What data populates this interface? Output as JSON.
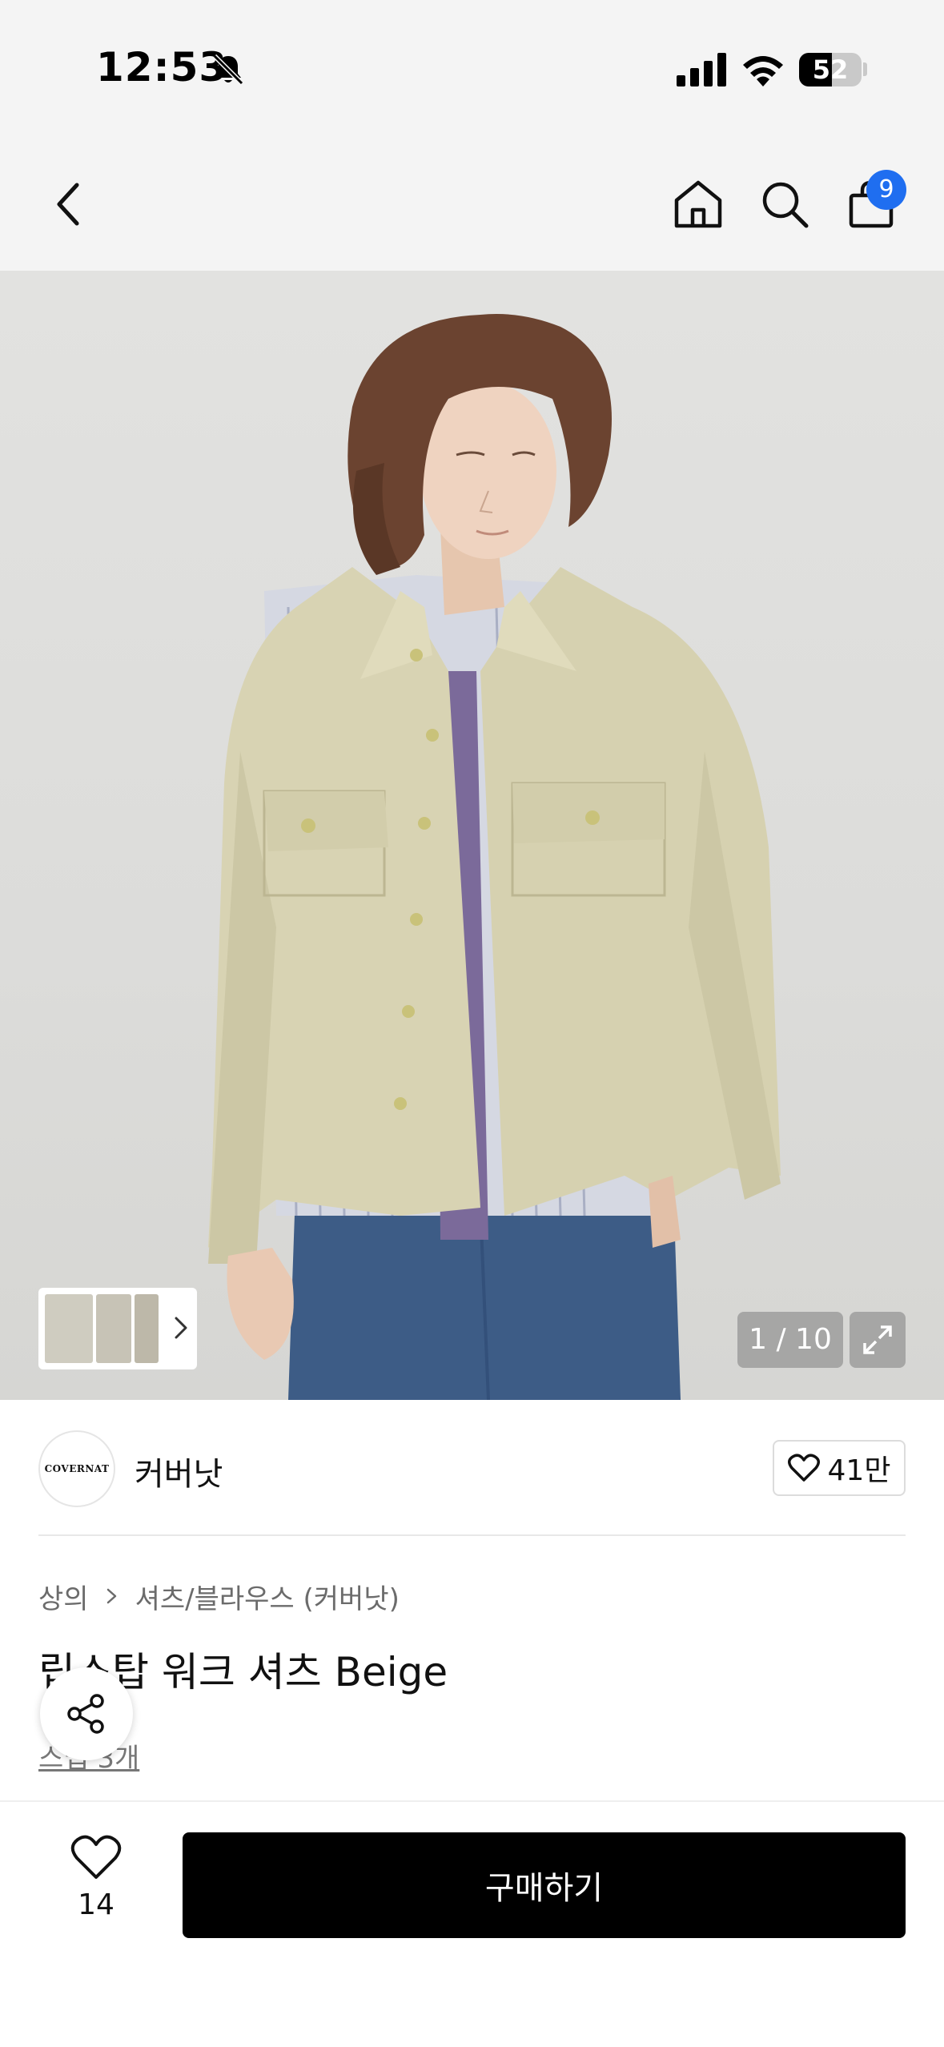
{
  "status_bar": {
    "time": "12:53",
    "battery": "52",
    "battery_level_percent": 52,
    "icons": [
      "bell-slash-icon",
      "cellular-signal-icon",
      "wifi-icon",
      "battery-icon"
    ]
  },
  "header": {
    "icons": [
      "chevron-left-icon",
      "home-icon",
      "search-icon",
      "shopping-bag-icon"
    ],
    "cart_badge": "9",
    "accent_color": "#1f6ef0"
  },
  "gallery": {
    "page_counter": "1 / 10",
    "icons": [
      "chevron-right-icon",
      "expand-icon"
    ]
  },
  "brand": {
    "logo_text": "COVERNAT",
    "name": "커버낫",
    "like_count": "41만",
    "icons": [
      "heart-outline-icon"
    ]
  },
  "product": {
    "breadcrumb": [
      "상의",
      "셔츠/블라우스 (커버낫)"
    ],
    "title": "립스탑 워크 셔츠 Beige",
    "review_link": "스냅 3개",
    "icons": [
      "share-icon"
    ]
  },
  "bottom_bar": {
    "wish_count": "14",
    "buy_label": "구매하기",
    "icons": [
      "heart-outline-icon"
    ]
  }
}
